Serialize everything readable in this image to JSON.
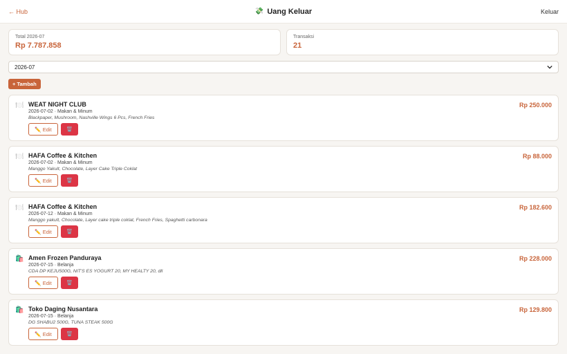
{
  "header": {
    "back_label": "← Hub",
    "title": "Uang Keluar",
    "title_icon": "💸",
    "logout_label": "Keluar"
  },
  "summary": {
    "total_label": "Total 2026-07",
    "total_value": "Rp 7.787.858",
    "count_label": "Transaksi",
    "count_value": "21"
  },
  "filter": {
    "month": "2026-07"
  },
  "add_label": "+ Tambah",
  "transactions": [
    {
      "icon": "🍽️",
      "title": "WEAT NIGHT CLUB",
      "meta": "2026-07-02 · Makan & Minum",
      "note": "Blackpaper, Mushroom, Nashville Wings 6 Pcs, French Fries",
      "amount": "Rp 250.000",
      "edit_label": "✏️ Edit",
      "delete_icon": "🗑️"
    },
    {
      "icon": "🍽️",
      "title": "HAFA Coffee & Kitchen",
      "meta": "2026-07-02 · Makan & Minum",
      "note": "Manggo Yakult, Chocolate, Layer Cake Triple Coklat",
      "amount": "Rp 88.000",
      "edit_label": "✏️ Edit",
      "delete_icon": "🗑️"
    },
    {
      "icon": "🍽️",
      "title": "HAFA Coffee & Kitchen",
      "meta": "2026-07-12 · Makan & Minum",
      "note": "Manggo yakult, Chocolate, Layer cake triple coklat, French Fries, Spaghetti carbonara",
      "amount": "Rp 182.600",
      "edit_label": "✏️ Edit",
      "delete_icon": "🗑️"
    },
    {
      "icon": "🛍️",
      "title": "Amen Frozen Panduraya",
      "meta": "2026-07-15 · Belanja",
      "note": "CDA DP KEJU500G, NIT'S ES YOGURT 20, MY HEALTY 20, dll",
      "amount": "Rp 228.000",
      "edit_label": "✏️ Edit",
      "delete_icon": "🗑️"
    },
    {
      "icon": "🛍️",
      "title": "Toko Daging Nusantara",
      "meta": "2026-07-15 · Belanja",
      "note": "DG SHABU2 500G, TUNA STEAK 500G",
      "amount": "Rp 129.800",
      "edit_label": "✏️ Edit",
      "delete_icon": "🗑️"
    }
  ]
}
